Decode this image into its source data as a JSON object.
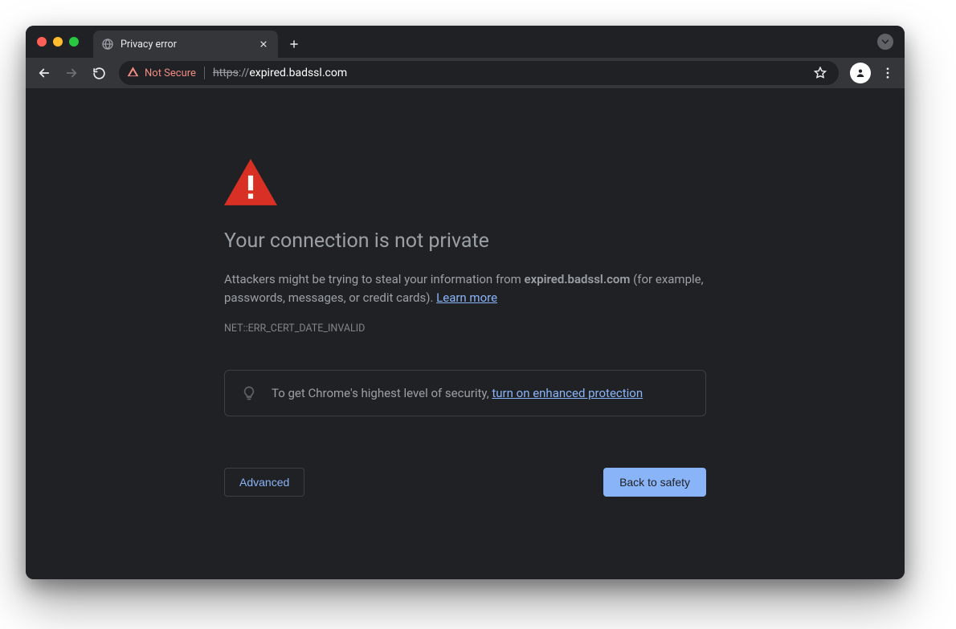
{
  "tab": {
    "title": "Privacy error"
  },
  "omnibox": {
    "not_secure_label": "Not Secure",
    "url_scheme": "https",
    "url_sep": "://",
    "url_host": "expired.badssl.com"
  },
  "page": {
    "heading": "Your connection is not private",
    "body_pre": "Attackers might be trying to steal your information from ",
    "body_host": "expired.badssl.com",
    "body_post": " (for example, passwords, messages, or credit cards). ",
    "learn_more": "Learn more",
    "error_code": "NET::ERR_CERT_DATE_INVALID",
    "promo_text": "To get Chrome's highest level of security, ",
    "promo_link": "turn on enhanced protection",
    "advanced_label": "Advanced",
    "back_label": "Back to safety"
  },
  "colors": {
    "red": "#d93025",
    "blue_link": "#8ab4f8"
  }
}
